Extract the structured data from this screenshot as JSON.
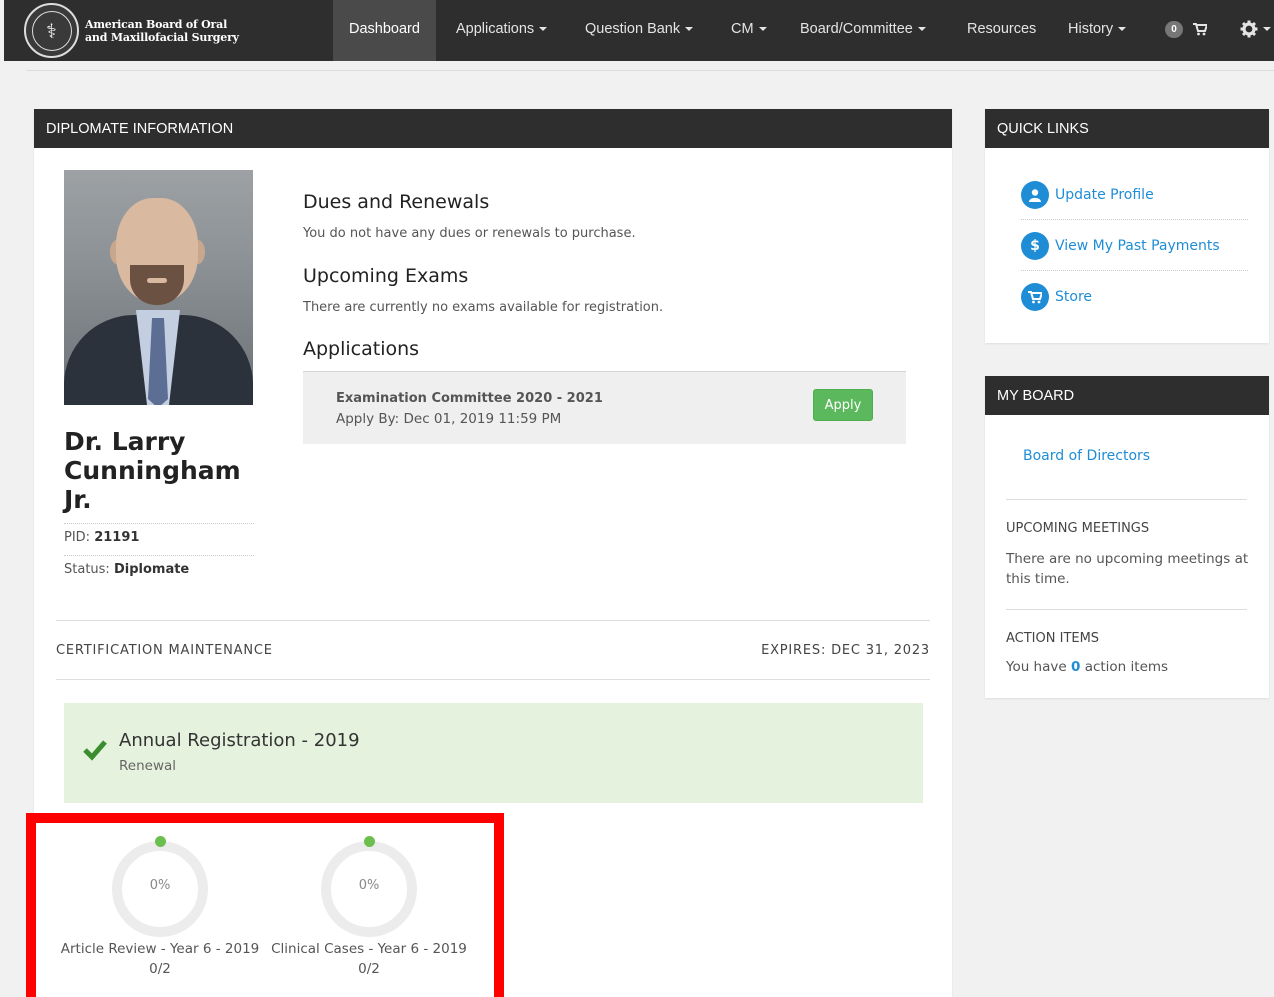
{
  "brand": {
    "line1": "American Board of Oral",
    "line2": "and Maxillofacial Surgery"
  },
  "nav": {
    "dashboard": "Dashboard",
    "applications": "Applications",
    "question_bank": "Question Bank",
    "cm": "CM",
    "board": "Board/Committee",
    "resources": "Resources",
    "history": "History",
    "cart_count": "0"
  },
  "diplomate": {
    "header": "DIPLOMATE INFORMATION",
    "name": "Dr. Larry Cunningham Jr.",
    "pid_label": "PID:",
    "pid": "21191",
    "status_label": "Status:",
    "status": "Diplomate",
    "dues_title": "Dues and Renewals",
    "dues_text": "You do not have any dues or renewals to purchase.",
    "exams_title": "Upcoming Exams",
    "exams_text": "There are currently no exams available for registration.",
    "apps_title": "Applications",
    "application": {
      "name": "Examination Committee 2020 - 2021",
      "apply_by": "Apply By: Dec 01, 2019 11:59 PM",
      "button": "Apply"
    },
    "cm_label": "CERTIFICATION MAINTENANCE",
    "expires": "EXPIRES: DEC 31, 2023",
    "annual": {
      "title": "Annual Registration - 2019",
      "subtitle": "Renewal"
    },
    "progress": [
      {
        "percent": "0%",
        "label": "Article Review - Year 6 - 2019",
        "count": "0/2",
        "value": 0
      },
      {
        "percent": "0%",
        "label": "Clinical Cases - Year 6 - 2019",
        "count": "0/2",
        "value": 0
      }
    ]
  },
  "quick_links": {
    "header": "QUICK LINKS",
    "items": [
      {
        "label": "Update Profile",
        "icon": "user-icon"
      },
      {
        "label": "View My Past Payments",
        "icon": "dollar-icon"
      },
      {
        "label": "Store",
        "icon": "cart-icon"
      }
    ]
  },
  "my_board": {
    "header": "MY BOARD",
    "board_link": "Board of Directors",
    "meetings_title": "UPCOMING MEETINGS",
    "meetings_text": "There are no upcoming meetings at this time.",
    "actions_title": "ACTION ITEMS",
    "actions_prefix": "You have",
    "actions_count": "0",
    "actions_suffix": "action items"
  },
  "colors": {
    "accent": "#1f8dd6",
    "success": "#5cb85c",
    "nav_bg": "#2e2e2e",
    "highlight": "#ff0000"
  }
}
